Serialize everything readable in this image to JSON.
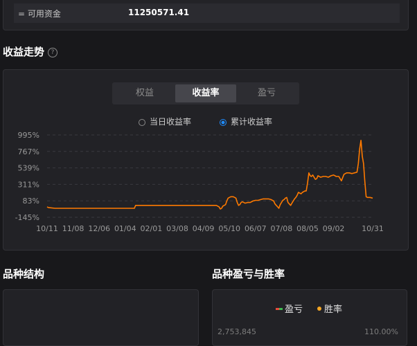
{
  "summary": {
    "label": "= 可用资金",
    "value": "11250571.41"
  },
  "trend": {
    "title": "收益走势",
    "help_icon": "?",
    "tabs": [
      {
        "label": "权益",
        "active": false
      },
      {
        "label": "收益率",
        "active": true
      },
      {
        "label": "盈亏",
        "active": false
      }
    ],
    "radios": [
      {
        "label": "当日收益率",
        "checked": false
      },
      {
        "label": "累计收益率",
        "checked": true
      }
    ]
  },
  "chart_data": {
    "type": "line",
    "color": "#ff7a00",
    "y_tick_labels": [
      "995%",
      "767%",
      "539%",
      "311%",
      "83%",
      "-145%"
    ],
    "y_ticks": [
      995,
      767,
      539,
      311,
      83,
      -145
    ],
    "ylim": [
      -145,
      995
    ],
    "x_tick_labels": [
      "10/11",
      "11/08",
      "12/06",
      "01/04",
      "02/01",
      "03/08",
      "04/09",
      "05/10",
      "06/07",
      "07/08",
      "08/05",
      "09/02",
      "10/31"
    ],
    "x_ticks": [
      0,
      20,
      40,
      60,
      80,
      100,
      120,
      140,
      160,
      180,
      200,
      220,
      250
    ],
    "xlim": [
      0,
      250
    ],
    "grid": "horizontal-dashed",
    "x": [
      0,
      1,
      6,
      20,
      40,
      60,
      67,
      68,
      80,
      100,
      120,
      130,
      132,
      133,
      134,
      135,
      137,
      138,
      139,
      141,
      143,
      144,
      145,
      146,
      147,
      148,
      149,
      150,
      151,
      152,
      154,
      156,
      158,
      160,
      162,
      164,
      166,
      168,
      170,
      172,
      174,
      175,
      176,
      177,
      178,
      179,
      180,
      181,
      182,
      183,
      184,
      185,
      186,
      187,
      188,
      189,
      190,
      191,
      192,
      193,
      194,
      195,
      196,
      197,
      198,
      199,
      200,
      201,
      202,
      203,
      204,
      205,
      206,
      207,
      208,
      210,
      212,
      214,
      216,
      218,
      220,
      222,
      224,
      226,
      228,
      230,
      232,
      234,
      236,
      238,
      239,
      240,
      241,
      242,
      243,
      244,
      245,
      246,
      248,
      250
    ],
    "values": [
      0,
      -10,
      -20,
      -20,
      -20,
      -20,
      -20,
      20,
      20,
      20,
      20,
      20,
      0,
      -30,
      -20,
      10,
      30,
      80,
      120,
      140,
      140,
      130,
      120,
      60,
      20,
      30,
      60,
      70,
      60,
      50,
      60,
      60,
      80,
      90,
      90,
      100,
      110,
      110,
      110,
      100,
      80,
      40,
      20,
      0,
      -20,
      30,
      60,
      90,
      100,
      120,
      130,
      60,
      40,
      20,
      50,
      80,
      110,
      130,
      160,
      200,
      190,
      180,
      200,
      210,
      220,
      220,
      330,
      470,
      430,
      420,
      440,
      410,
      380,
      390,
      430,
      410,
      420,
      420,
      410,
      430,
      440,
      420,
      420,
      360,
      450,
      470,
      470,
      460,
      470,
      480,
      600,
      800,
      920,
      700,
      600,
      350,
      140,
      130,
      130,
      120,
      110
    ]
  },
  "structure": {
    "title": "品种结构"
  },
  "pnl_win": {
    "title": "品种盈亏与胜率",
    "legend": [
      {
        "label": "盈亏",
        "icon": "line-marker-icon"
      },
      {
        "label": "胜率",
        "icon": "dot-marker-icon"
      }
    ],
    "left_axis_top": "2,753,845",
    "right_axis_top": "110.00%"
  },
  "colors": {
    "line": "#ff7a00",
    "accent": "#1f8cff",
    "pnl_legend_red": "#e84b3c",
    "pnl_legend_green": "#3fb950",
    "win_legend": "#f5a623"
  }
}
